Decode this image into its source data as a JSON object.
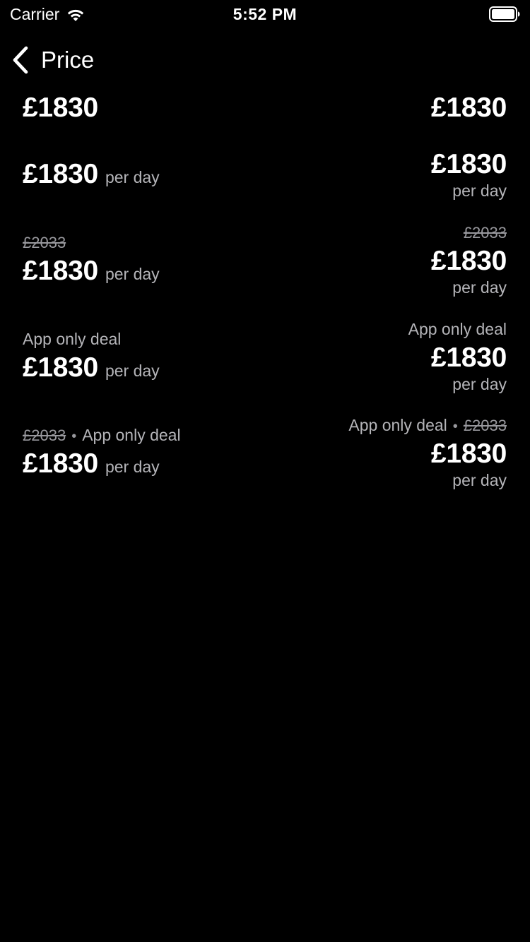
{
  "status_bar": {
    "carrier": "Carrier",
    "time": "5:52 PM",
    "wifi_icon": "wifi-icon",
    "battery_icon": "battery-full-icon"
  },
  "nav": {
    "back_icon": "chevron-left-icon",
    "back_label": "Price"
  },
  "rows": [
    {
      "left": {
        "price": "£1830"
      },
      "right": {
        "price": "£1830"
      }
    },
    {
      "left": {
        "price": "£1830",
        "unit": "per day"
      },
      "right": {
        "price": "£1830",
        "unit": "per day"
      }
    },
    {
      "left": {
        "old_price": "£2033",
        "price": "£1830",
        "unit": "per day"
      },
      "right": {
        "old_price": "£2033",
        "price": "£1830",
        "unit": "per day"
      }
    },
    {
      "left": {
        "promo": "App only deal",
        "price": "£1830",
        "unit": "per day"
      },
      "right": {
        "promo": "App only deal",
        "price": "£1830",
        "unit": "per day"
      }
    },
    {
      "left": {
        "old_price": "£2033",
        "separator": "•",
        "promo": "App only deal",
        "price": "£1830",
        "unit": "per day"
      },
      "right": {
        "promo": "App only deal",
        "separator": "•",
        "old_price": "£2033",
        "price": "£1830",
        "unit": "per day"
      }
    }
  ],
  "colors": {
    "background": "#000000",
    "text_primary": "#ffffff",
    "text_secondary": "#b4b4b8",
    "text_strikethrough": "#98989d"
  }
}
